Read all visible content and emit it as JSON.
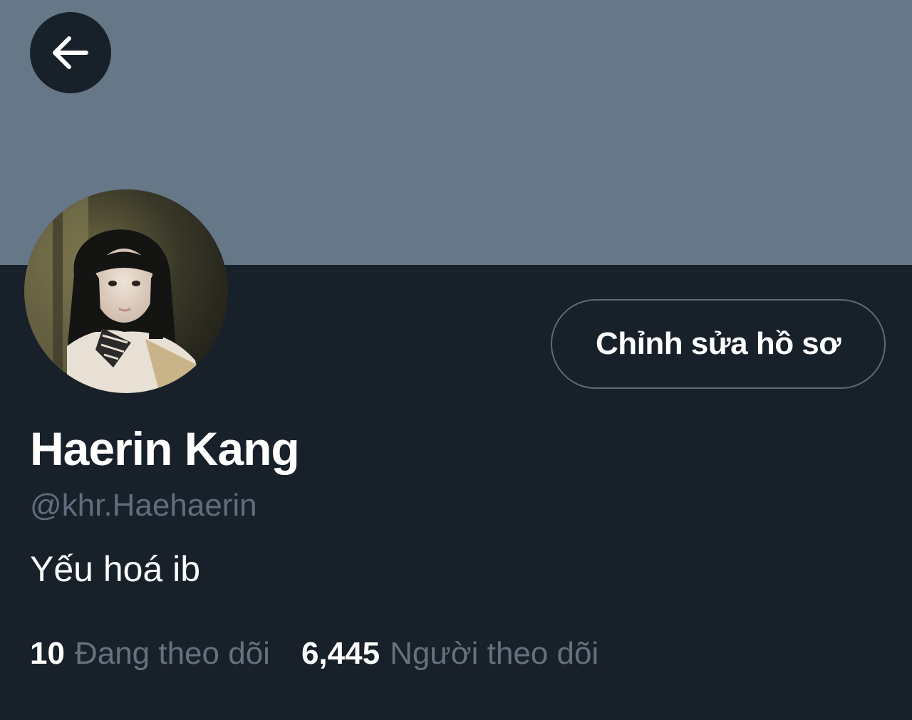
{
  "header": {
    "back_icon": "arrow-left-icon"
  },
  "profile": {
    "display_name": "Haerin Kang",
    "handle": "@khr.Haehaerin",
    "bio": "Yếu hoá ib",
    "edit_button_label": "Chỉnh sửa hồ sơ"
  },
  "stats": {
    "following_count": "10",
    "following_label": "Đang theo dõi",
    "followers_count": "6,445",
    "followers_label": "Người theo dõi"
  },
  "colors": {
    "banner": "#667788",
    "background": "#18202a",
    "muted_text": "#66717e",
    "button_border": "#5c6b7a"
  }
}
